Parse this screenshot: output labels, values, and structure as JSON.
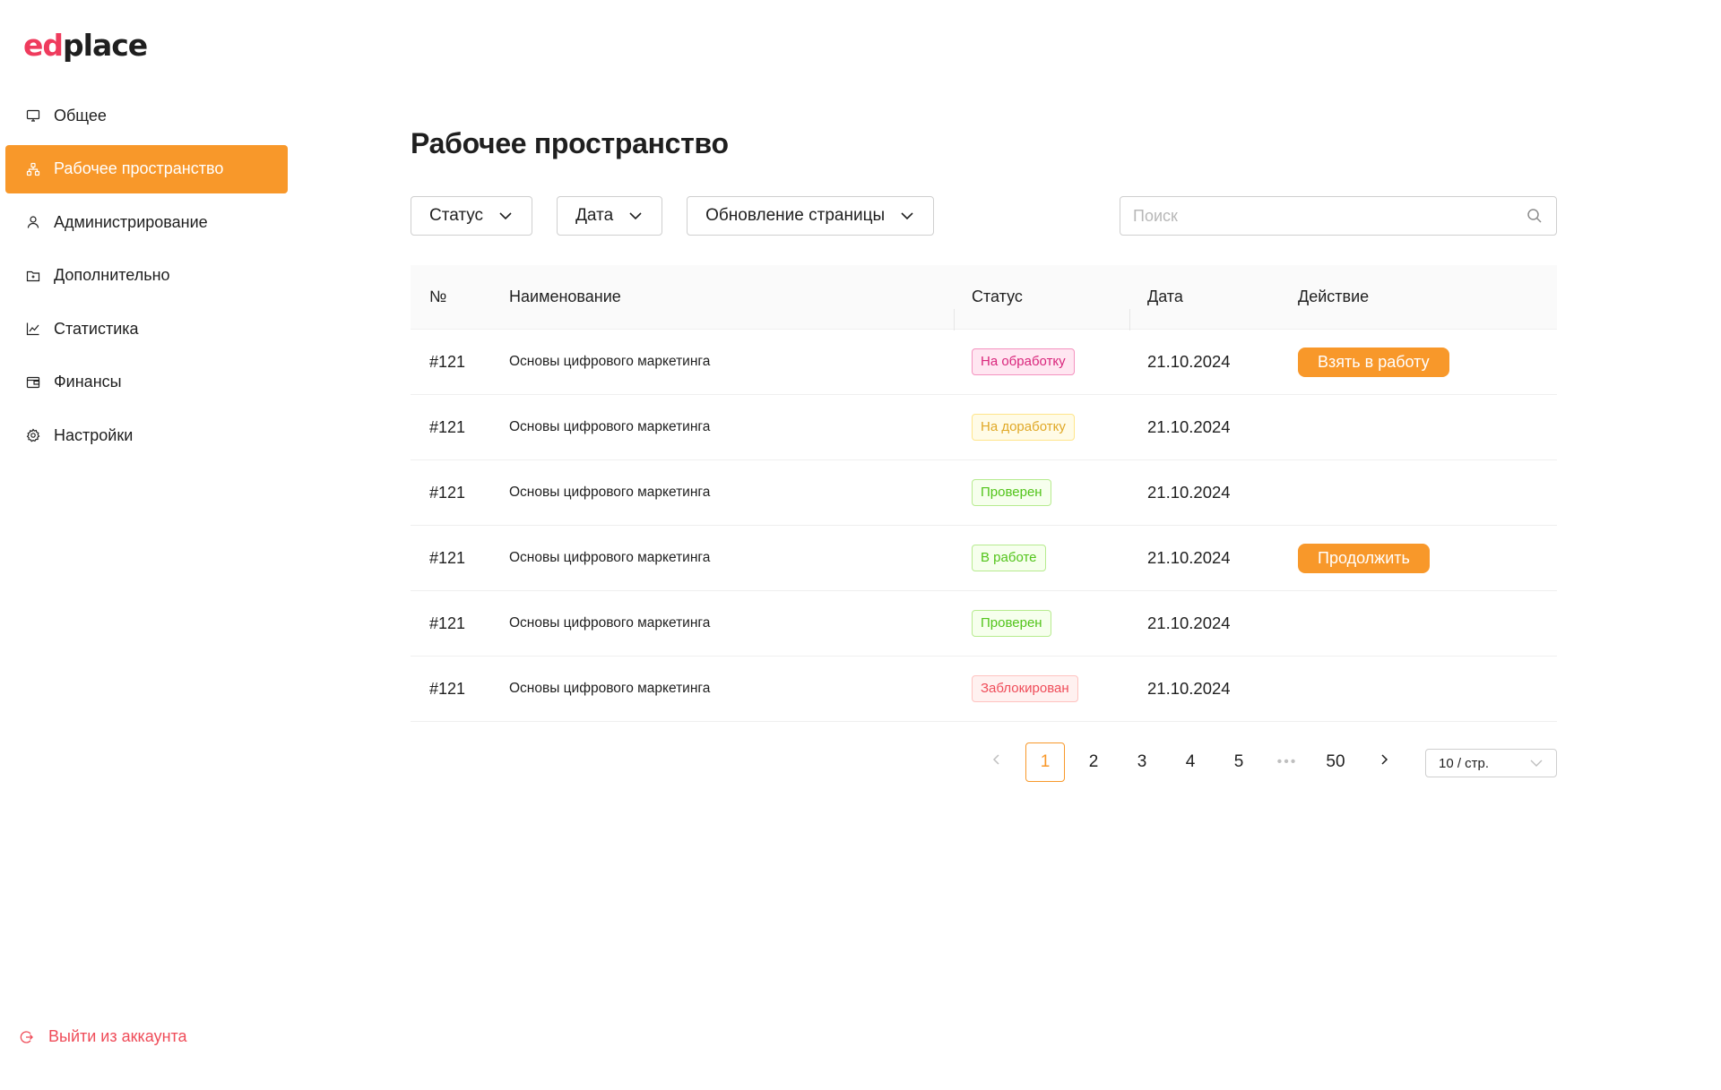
{
  "brand": {
    "logo_part1": "ed",
    "logo_part2": "place",
    "accent": "#f8982a",
    "logo_color": "#ef3b5d"
  },
  "sidebar": {
    "items": [
      {
        "label": "Общее",
        "icon": "monitor-icon"
      },
      {
        "label": "Рабочее пространство",
        "icon": "network-icon",
        "active": true
      },
      {
        "label": "Администрирование",
        "icon": "user-icon"
      },
      {
        "label": "Дополнительно",
        "icon": "folder-icon"
      },
      {
        "label": "Статистика",
        "icon": "line-chart-icon"
      },
      {
        "label": "Финансы",
        "icon": "wallet-icon"
      },
      {
        "label": "Настройки",
        "icon": "gear-icon"
      }
    ],
    "logout_label": "Выйти из аккаунта"
  },
  "main": {
    "title": "Рабочее пространство",
    "filters": {
      "status_label": "Статус",
      "date_label": "Дата",
      "refresh_label": "Обновление страницы"
    },
    "search": {
      "placeholder": "Поиск",
      "value": ""
    }
  },
  "table": {
    "headers": {
      "no": "№",
      "name": "Наименование",
      "status": "Статус",
      "date": "Дата",
      "action": "Действие"
    },
    "rows": [
      {
        "no": "#121",
        "name": "Основы цифрового маркетинга",
        "status": "На обработку",
        "status_color": "pink",
        "date": "21.10.2024",
        "action": "Взять в работу"
      },
      {
        "no": "#121",
        "name": "Основы цифрового маркетинга",
        "status": "На доработку",
        "status_color": "yellow",
        "date": "21.10.2024",
        "action": ""
      },
      {
        "no": "#121",
        "name": "Основы цифрового маркетинга",
        "status": "Проверен",
        "status_color": "green",
        "date": "21.10.2024",
        "action": ""
      },
      {
        "no": "#121",
        "name": "Основы цифрового маркетинга",
        "status": "В работе",
        "status_color": "green",
        "date": "21.10.2024",
        "action": "Продолжить"
      },
      {
        "no": "#121",
        "name": "Основы цифрового маркетинга",
        "status": "Проверен",
        "status_color": "green",
        "date": "21.10.2024",
        "action": ""
      },
      {
        "no": "#121",
        "name": "Основы цифрового маркетинга",
        "status": "Заблокирован",
        "status_color": "red",
        "date": "21.10.2024",
        "action": ""
      }
    ]
  },
  "pagination": {
    "pages": [
      "1",
      "2",
      "3",
      "4",
      "5"
    ],
    "current": "1",
    "ellipsis": "•••",
    "last": "50",
    "page_size_label": "10 / стр."
  }
}
